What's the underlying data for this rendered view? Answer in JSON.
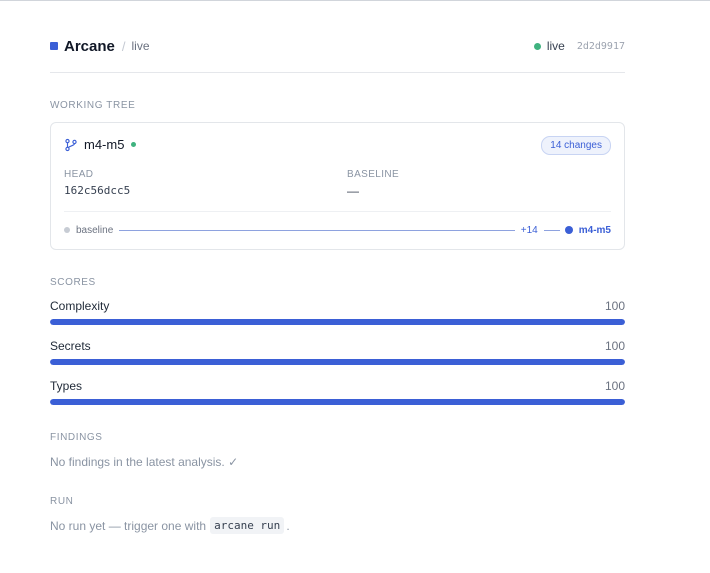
{
  "header": {
    "brand": "Arcane",
    "separator": "/",
    "crumb": "live",
    "status": "live",
    "hash": "2d2d9917",
    "brand_color": "#3b5fd6",
    "live_color": "#3fb27f"
  },
  "working_tree": {
    "section_label": "WORKING TREE",
    "branch": "m4-m5",
    "branch_icon": "git-branch-icon",
    "changes_badge": "14 changes",
    "head_label": "HEAD",
    "head_value": "162c56dcc5",
    "baseline_label": "BASELINE",
    "baseline_value": "—",
    "timeline": {
      "start": "baseline",
      "count": "+14",
      "end": "m4-m5"
    }
  },
  "scores": {
    "section_label": "SCORES",
    "items": [
      {
        "name": "Complexity",
        "value": "100",
        "fill_percent": 100
      },
      {
        "name": "Secrets",
        "value": "100",
        "fill_percent": 100
      },
      {
        "name": "Types",
        "value": "100",
        "fill_percent": 100
      }
    ]
  },
  "findings": {
    "section_label": "FINDINGS",
    "text": "No findings in the latest analysis. ✓"
  },
  "run": {
    "section_label": "RUN",
    "text_before": "No run yet — trigger one with",
    "command": "arcane run",
    "text_after": "."
  }
}
